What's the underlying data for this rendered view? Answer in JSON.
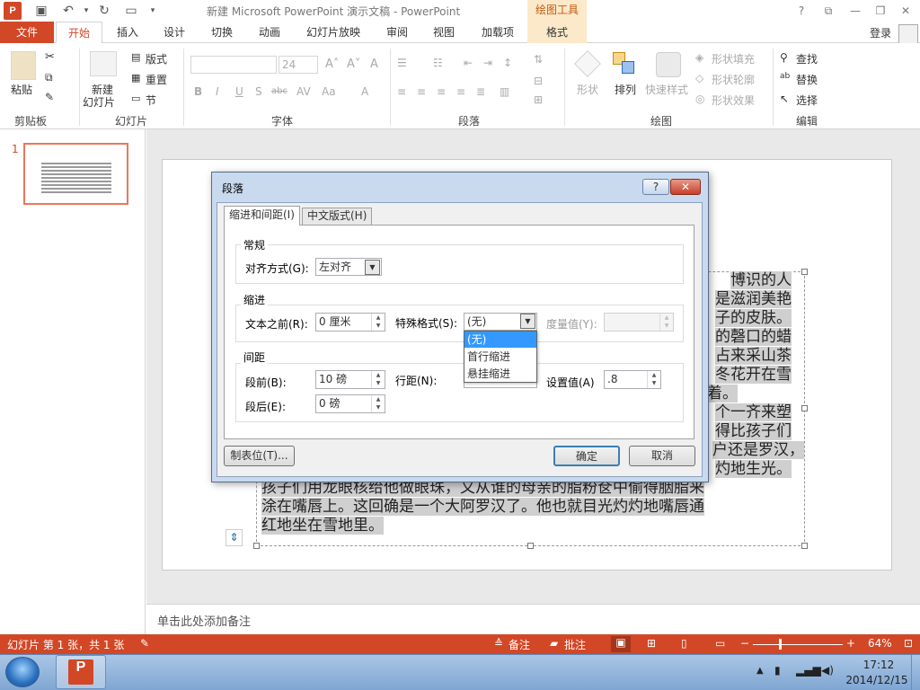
{
  "titlebar": {
    "app_icon": "P",
    "title": "新建 Microsoft PowerPoint 演示文稿 - PowerPoint",
    "context_group": "绘图工具",
    "help": "?",
    "ribbon_display": "⧉",
    "minimize": "—",
    "restore": "❐",
    "close": "✕"
  },
  "tabs": {
    "file": "文件",
    "home": "开始",
    "insert": "插入",
    "design": "设计",
    "transitions": "切换",
    "animations": "动画",
    "slideshow": "幻灯片放映",
    "review": "审阅",
    "view": "视图",
    "addins": "加载项",
    "format": "格式"
  },
  "account": {
    "login": "登录"
  },
  "ribbon": {
    "clipboard": {
      "label": "剪贴板",
      "paste": "粘贴"
    },
    "slides": {
      "label": "幻灯片",
      "new_slide_1": "新建",
      "new_slide_2": "幻灯片",
      "layout": "版式",
      "reset": "重置",
      "section": "节"
    },
    "font": {
      "label": "字体",
      "size": "24"
    },
    "paragraph": {
      "label": "段落"
    },
    "drawing": {
      "label": "绘图",
      "shapes": "形状",
      "arrange": "排列",
      "quick_styles": "快速样式",
      "shape_fill": "形状填充",
      "shape_outline": "形状轮廓",
      "shape_effects": "形状效果"
    },
    "editing": {
      "label": "编辑",
      "find": "查找",
      "replace": "替换",
      "select": "选择"
    }
  },
  "thumbnail": {
    "number": "1"
  },
  "slide_text": {
    "line1": "博识的人",
    "line2": "是滋润美艳",
    "line3": "子的皮肤。",
    "line4": "的磬口的蜡",
    "line5": "占来采山茶",
    "line6": "冬花开在雪",
    "line7": "着。",
    "line8": "个一齐来塑",
    "line9": "得比孩子们",
    "line10": "户还是罗汉，",
    "line11": "灼地生光。",
    "line12": "孩子们用龙眼核给他做眼珠，又从谁的母亲的脂粉奁中偷得胭脂来",
    "line13": "涂在嘴唇上。这回确是一个大阿罗汉了。他也就目光灼灼地嘴唇通",
    "line14": "红地坐在雪地里。"
  },
  "notes": {
    "placeholder": "单击此处添加备注"
  },
  "statusbar": {
    "slide_info": "幻灯片 第 1 张，共 1 张",
    "notes": "备注",
    "comments": "批注",
    "zoom": "64%"
  },
  "taskbar": {
    "time": "17:12",
    "date": "2014/12/15",
    "ppt_icon": "P"
  },
  "dialog": {
    "title": "段落",
    "help": "?",
    "close": "✕",
    "tabs": {
      "indent_spacing": "缩进和间距(I)",
      "chinese_layout": "中文版式(H)"
    },
    "general": {
      "section": "常规",
      "alignment_label": "对齐方式(G):",
      "alignment_value": "左对齐"
    },
    "indent": {
      "section": "缩进",
      "before_text_label": "文本之前(R):",
      "before_text_value": "0 厘米",
      "special_label": "特殊格式(S):",
      "special_value": "(无)",
      "measure_label": "度量值(Y):",
      "options": [
        "(无)",
        "首行缩进",
        "悬挂缩进"
      ]
    },
    "spacing": {
      "section": "间距",
      "before_label": "段前(B):",
      "before_value": "10 磅",
      "after_label": "段后(E):",
      "after_value": "0 磅",
      "line_label": "行距(N):",
      "set_label": "设置值(A)",
      "set_value": ".8"
    },
    "buttons": {
      "tabs": "制表位(T)...",
      "ok": "确定",
      "cancel": "取消"
    }
  }
}
